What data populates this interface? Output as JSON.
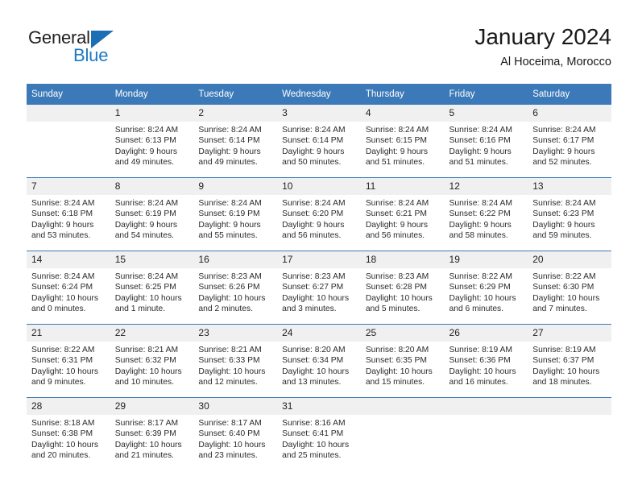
{
  "brand": {
    "name_top": "General",
    "name_bottom": "Blue",
    "triangle_color": "#1c6fb5",
    "blue_color": "#1c7ac4"
  },
  "header": {
    "title": "January 2024",
    "subtitle": "Al Hoceima, Morocco"
  },
  "theme": {
    "header_bg": "#3b79b8",
    "daynum_bg": "#f0f0f0",
    "separator": "#3b79b8"
  },
  "weekday_headers": [
    "Sunday",
    "Monday",
    "Tuesday",
    "Wednesday",
    "Thursday",
    "Friday",
    "Saturday"
  ],
  "weeks": [
    [
      {
        "day": "",
        "blank": true,
        "sunrise": "",
        "sunset": "",
        "daylight_1": "",
        "daylight_2": ""
      },
      {
        "day": "1",
        "sunrise": "Sunrise: 8:24 AM",
        "sunset": "Sunset: 6:13 PM",
        "daylight_1": "Daylight: 9 hours",
        "daylight_2": "and 49 minutes."
      },
      {
        "day": "2",
        "sunrise": "Sunrise: 8:24 AM",
        "sunset": "Sunset: 6:14 PM",
        "daylight_1": "Daylight: 9 hours",
        "daylight_2": "and 49 minutes."
      },
      {
        "day": "3",
        "sunrise": "Sunrise: 8:24 AM",
        "sunset": "Sunset: 6:14 PM",
        "daylight_1": "Daylight: 9 hours",
        "daylight_2": "and 50 minutes."
      },
      {
        "day": "4",
        "sunrise": "Sunrise: 8:24 AM",
        "sunset": "Sunset: 6:15 PM",
        "daylight_1": "Daylight: 9 hours",
        "daylight_2": "and 51 minutes."
      },
      {
        "day": "5",
        "sunrise": "Sunrise: 8:24 AM",
        "sunset": "Sunset: 6:16 PM",
        "daylight_1": "Daylight: 9 hours",
        "daylight_2": "and 51 minutes."
      },
      {
        "day": "6",
        "sunrise": "Sunrise: 8:24 AM",
        "sunset": "Sunset: 6:17 PM",
        "daylight_1": "Daylight: 9 hours",
        "daylight_2": "and 52 minutes."
      }
    ],
    [
      {
        "day": "7",
        "sunrise": "Sunrise: 8:24 AM",
        "sunset": "Sunset: 6:18 PM",
        "daylight_1": "Daylight: 9 hours",
        "daylight_2": "and 53 minutes."
      },
      {
        "day": "8",
        "sunrise": "Sunrise: 8:24 AM",
        "sunset": "Sunset: 6:19 PM",
        "daylight_1": "Daylight: 9 hours",
        "daylight_2": "and 54 minutes."
      },
      {
        "day": "9",
        "sunrise": "Sunrise: 8:24 AM",
        "sunset": "Sunset: 6:19 PM",
        "daylight_1": "Daylight: 9 hours",
        "daylight_2": "and 55 minutes."
      },
      {
        "day": "10",
        "sunrise": "Sunrise: 8:24 AM",
        "sunset": "Sunset: 6:20 PM",
        "daylight_1": "Daylight: 9 hours",
        "daylight_2": "and 56 minutes."
      },
      {
        "day": "11",
        "sunrise": "Sunrise: 8:24 AM",
        "sunset": "Sunset: 6:21 PM",
        "daylight_1": "Daylight: 9 hours",
        "daylight_2": "and 56 minutes."
      },
      {
        "day": "12",
        "sunrise": "Sunrise: 8:24 AM",
        "sunset": "Sunset: 6:22 PM",
        "daylight_1": "Daylight: 9 hours",
        "daylight_2": "and 58 minutes."
      },
      {
        "day": "13",
        "sunrise": "Sunrise: 8:24 AM",
        "sunset": "Sunset: 6:23 PM",
        "daylight_1": "Daylight: 9 hours",
        "daylight_2": "and 59 minutes."
      }
    ],
    [
      {
        "day": "14",
        "sunrise": "Sunrise: 8:24 AM",
        "sunset": "Sunset: 6:24 PM",
        "daylight_1": "Daylight: 10 hours",
        "daylight_2": "and 0 minutes."
      },
      {
        "day": "15",
        "sunrise": "Sunrise: 8:24 AM",
        "sunset": "Sunset: 6:25 PM",
        "daylight_1": "Daylight: 10 hours",
        "daylight_2": "and 1 minute."
      },
      {
        "day": "16",
        "sunrise": "Sunrise: 8:23 AM",
        "sunset": "Sunset: 6:26 PM",
        "daylight_1": "Daylight: 10 hours",
        "daylight_2": "and 2 minutes."
      },
      {
        "day": "17",
        "sunrise": "Sunrise: 8:23 AM",
        "sunset": "Sunset: 6:27 PM",
        "daylight_1": "Daylight: 10 hours",
        "daylight_2": "and 3 minutes."
      },
      {
        "day": "18",
        "sunrise": "Sunrise: 8:23 AM",
        "sunset": "Sunset: 6:28 PM",
        "daylight_1": "Daylight: 10 hours",
        "daylight_2": "and 5 minutes."
      },
      {
        "day": "19",
        "sunrise": "Sunrise: 8:22 AM",
        "sunset": "Sunset: 6:29 PM",
        "daylight_1": "Daylight: 10 hours",
        "daylight_2": "and 6 minutes."
      },
      {
        "day": "20",
        "sunrise": "Sunrise: 8:22 AM",
        "sunset": "Sunset: 6:30 PM",
        "daylight_1": "Daylight: 10 hours",
        "daylight_2": "and 7 minutes."
      }
    ],
    [
      {
        "day": "21",
        "sunrise": "Sunrise: 8:22 AM",
        "sunset": "Sunset: 6:31 PM",
        "daylight_1": "Daylight: 10 hours",
        "daylight_2": "and 9 minutes."
      },
      {
        "day": "22",
        "sunrise": "Sunrise: 8:21 AM",
        "sunset": "Sunset: 6:32 PM",
        "daylight_1": "Daylight: 10 hours",
        "daylight_2": "and 10 minutes."
      },
      {
        "day": "23",
        "sunrise": "Sunrise: 8:21 AM",
        "sunset": "Sunset: 6:33 PM",
        "daylight_1": "Daylight: 10 hours",
        "daylight_2": "and 12 minutes."
      },
      {
        "day": "24",
        "sunrise": "Sunrise: 8:20 AM",
        "sunset": "Sunset: 6:34 PM",
        "daylight_1": "Daylight: 10 hours",
        "daylight_2": "and 13 minutes."
      },
      {
        "day": "25",
        "sunrise": "Sunrise: 8:20 AM",
        "sunset": "Sunset: 6:35 PM",
        "daylight_1": "Daylight: 10 hours",
        "daylight_2": "and 15 minutes."
      },
      {
        "day": "26",
        "sunrise": "Sunrise: 8:19 AM",
        "sunset": "Sunset: 6:36 PM",
        "daylight_1": "Daylight: 10 hours",
        "daylight_2": "and 16 minutes."
      },
      {
        "day": "27",
        "sunrise": "Sunrise: 8:19 AM",
        "sunset": "Sunset: 6:37 PM",
        "daylight_1": "Daylight: 10 hours",
        "daylight_2": "and 18 minutes."
      }
    ],
    [
      {
        "day": "28",
        "sunrise": "Sunrise: 8:18 AM",
        "sunset": "Sunset: 6:38 PM",
        "daylight_1": "Daylight: 10 hours",
        "daylight_2": "and 20 minutes."
      },
      {
        "day": "29",
        "sunrise": "Sunrise: 8:17 AM",
        "sunset": "Sunset: 6:39 PM",
        "daylight_1": "Daylight: 10 hours",
        "daylight_2": "and 21 minutes."
      },
      {
        "day": "30",
        "sunrise": "Sunrise: 8:17 AM",
        "sunset": "Sunset: 6:40 PM",
        "daylight_1": "Daylight: 10 hours",
        "daylight_2": "and 23 minutes."
      },
      {
        "day": "31",
        "sunrise": "Sunrise: 8:16 AM",
        "sunset": "Sunset: 6:41 PM",
        "daylight_1": "Daylight: 10 hours",
        "daylight_2": "and 25 minutes."
      },
      {
        "day": "",
        "blank": true,
        "sunrise": "",
        "sunset": "",
        "daylight_1": "",
        "daylight_2": ""
      },
      {
        "day": "",
        "blank": true,
        "sunrise": "",
        "sunset": "",
        "daylight_1": "",
        "daylight_2": ""
      },
      {
        "day": "",
        "blank": true,
        "sunrise": "",
        "sunset": "",
        "daylight_1": "",
        "daylight_2": ""
      }
    ]
  ]
}
